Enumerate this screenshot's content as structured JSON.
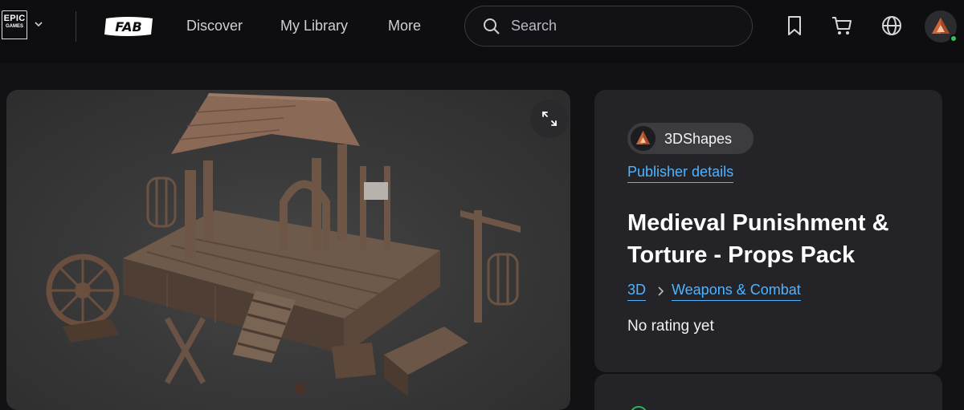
{
  "header": {
    "brand_epic_line1": "EPIC",
    "brand_epic_line2": "GAMES",
    "brand_fab": "FAB",
    "nav": [
      "Discover",
      "My Library",
      "More"
    ],
    "search_placeholder": "Search"
  },
  "product": {
    "publisher": "3DShapes",
    "publisher_link": "Publisher details",
    "title": "Medieval Punishment & Torture - Props Pack",
    "breadcrumb": [
      "3D",
      "Weapons & Combat"
    ],
    "rating": "No rating yet"
  },
  "colors": {
    "link": "#4fb3ff",
    "online_indicator": "#34c15a",
    "panel_bg": "#242428",
    "page_bg": "#121215"
  },
  "icons": [
    "epic-games-logo",
    "chevron-down-icon",
    "fab-logo",
    "search-icon",
    "bookmark-icon",
    "cart-icon",
    "globe-icon",
    "avatar",
    "expand-icon",
    "chevron-right-icon"
  ]
}
